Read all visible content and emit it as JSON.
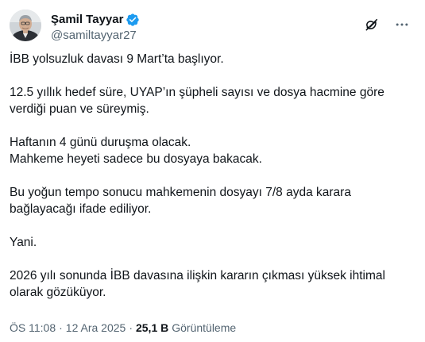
{
  "author": {
    "name": "Şamil Tayyar",
    "handle": "@samiltayyar27",
    "verified": true,
    "verified_color": "#1d9bf0"
  },
  "actions": {
    "grok_icon": "grok-icon",
    "more_icon": "more-icon"
  },
  "body": {
    "paragraphs": [
      "İBB yolsuzluk davası 9 Mart’ta başlıyor.",
      "12.5 yıllık hedef süre, UYAP’ın şüpheli sayısı ve dosya hacmine göre\nverdiği puan ve süreymiş.",
      "Haftanın 4 günü duruşma olacak.\nMahkeme heyeti sadece bu dosyaya bakacak.",
      "Bu yoğun tempo sonucu mahkemenin dosyayı 7/8 ayda karara\nbağlayacağı ifade ediliyor.",
      "Yani.",
      "2026 yılı sonunda İBB davasına ilişkin kararın çıkması yüksek ihtimal\nolarak gözüküyor."
    ]
  },
  "meta": {
    "time": "ÖS 11:08",
    "separator": "·",
    "date": "12 Ara 2025",
    "views_count": "25,1 B",
    "views_label": "Görüntüleme"
  }
}
